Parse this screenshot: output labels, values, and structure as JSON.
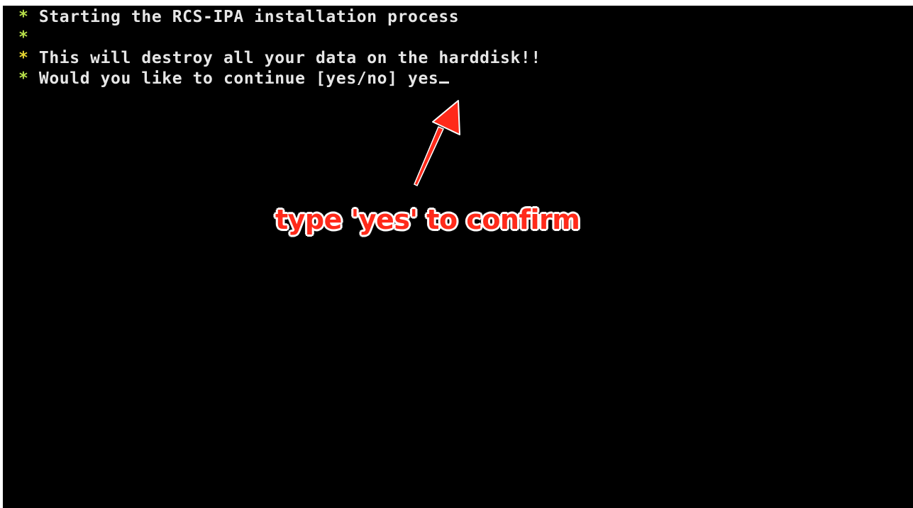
{
  "console": {
    "line1": {
      "bullet": "*",
      "text": "Starting the RCS-IPA installation process"
    },
    "line2": {
      "bullet": "*",
      "text": ""
    },
    "line3": {
      "bullet": "*",
      "text": "This will destroy all your data on the harddisk!!"
    },
    "line4": {
      "bullet": "*",
      "prompt": "Would you like to continue [yes/no]",
      "input": "yes"
    }
  },
  "annotation": {
    "text": "type 'yes' to confirm",
    "color": "#ff2a1a"
  },
  "colors": {
    "background": "#000000",
    "text": "#e6e6e6",
    "bullet": "#b8e04a",
    "bullet_warning": "#e8d832"
  }
}
